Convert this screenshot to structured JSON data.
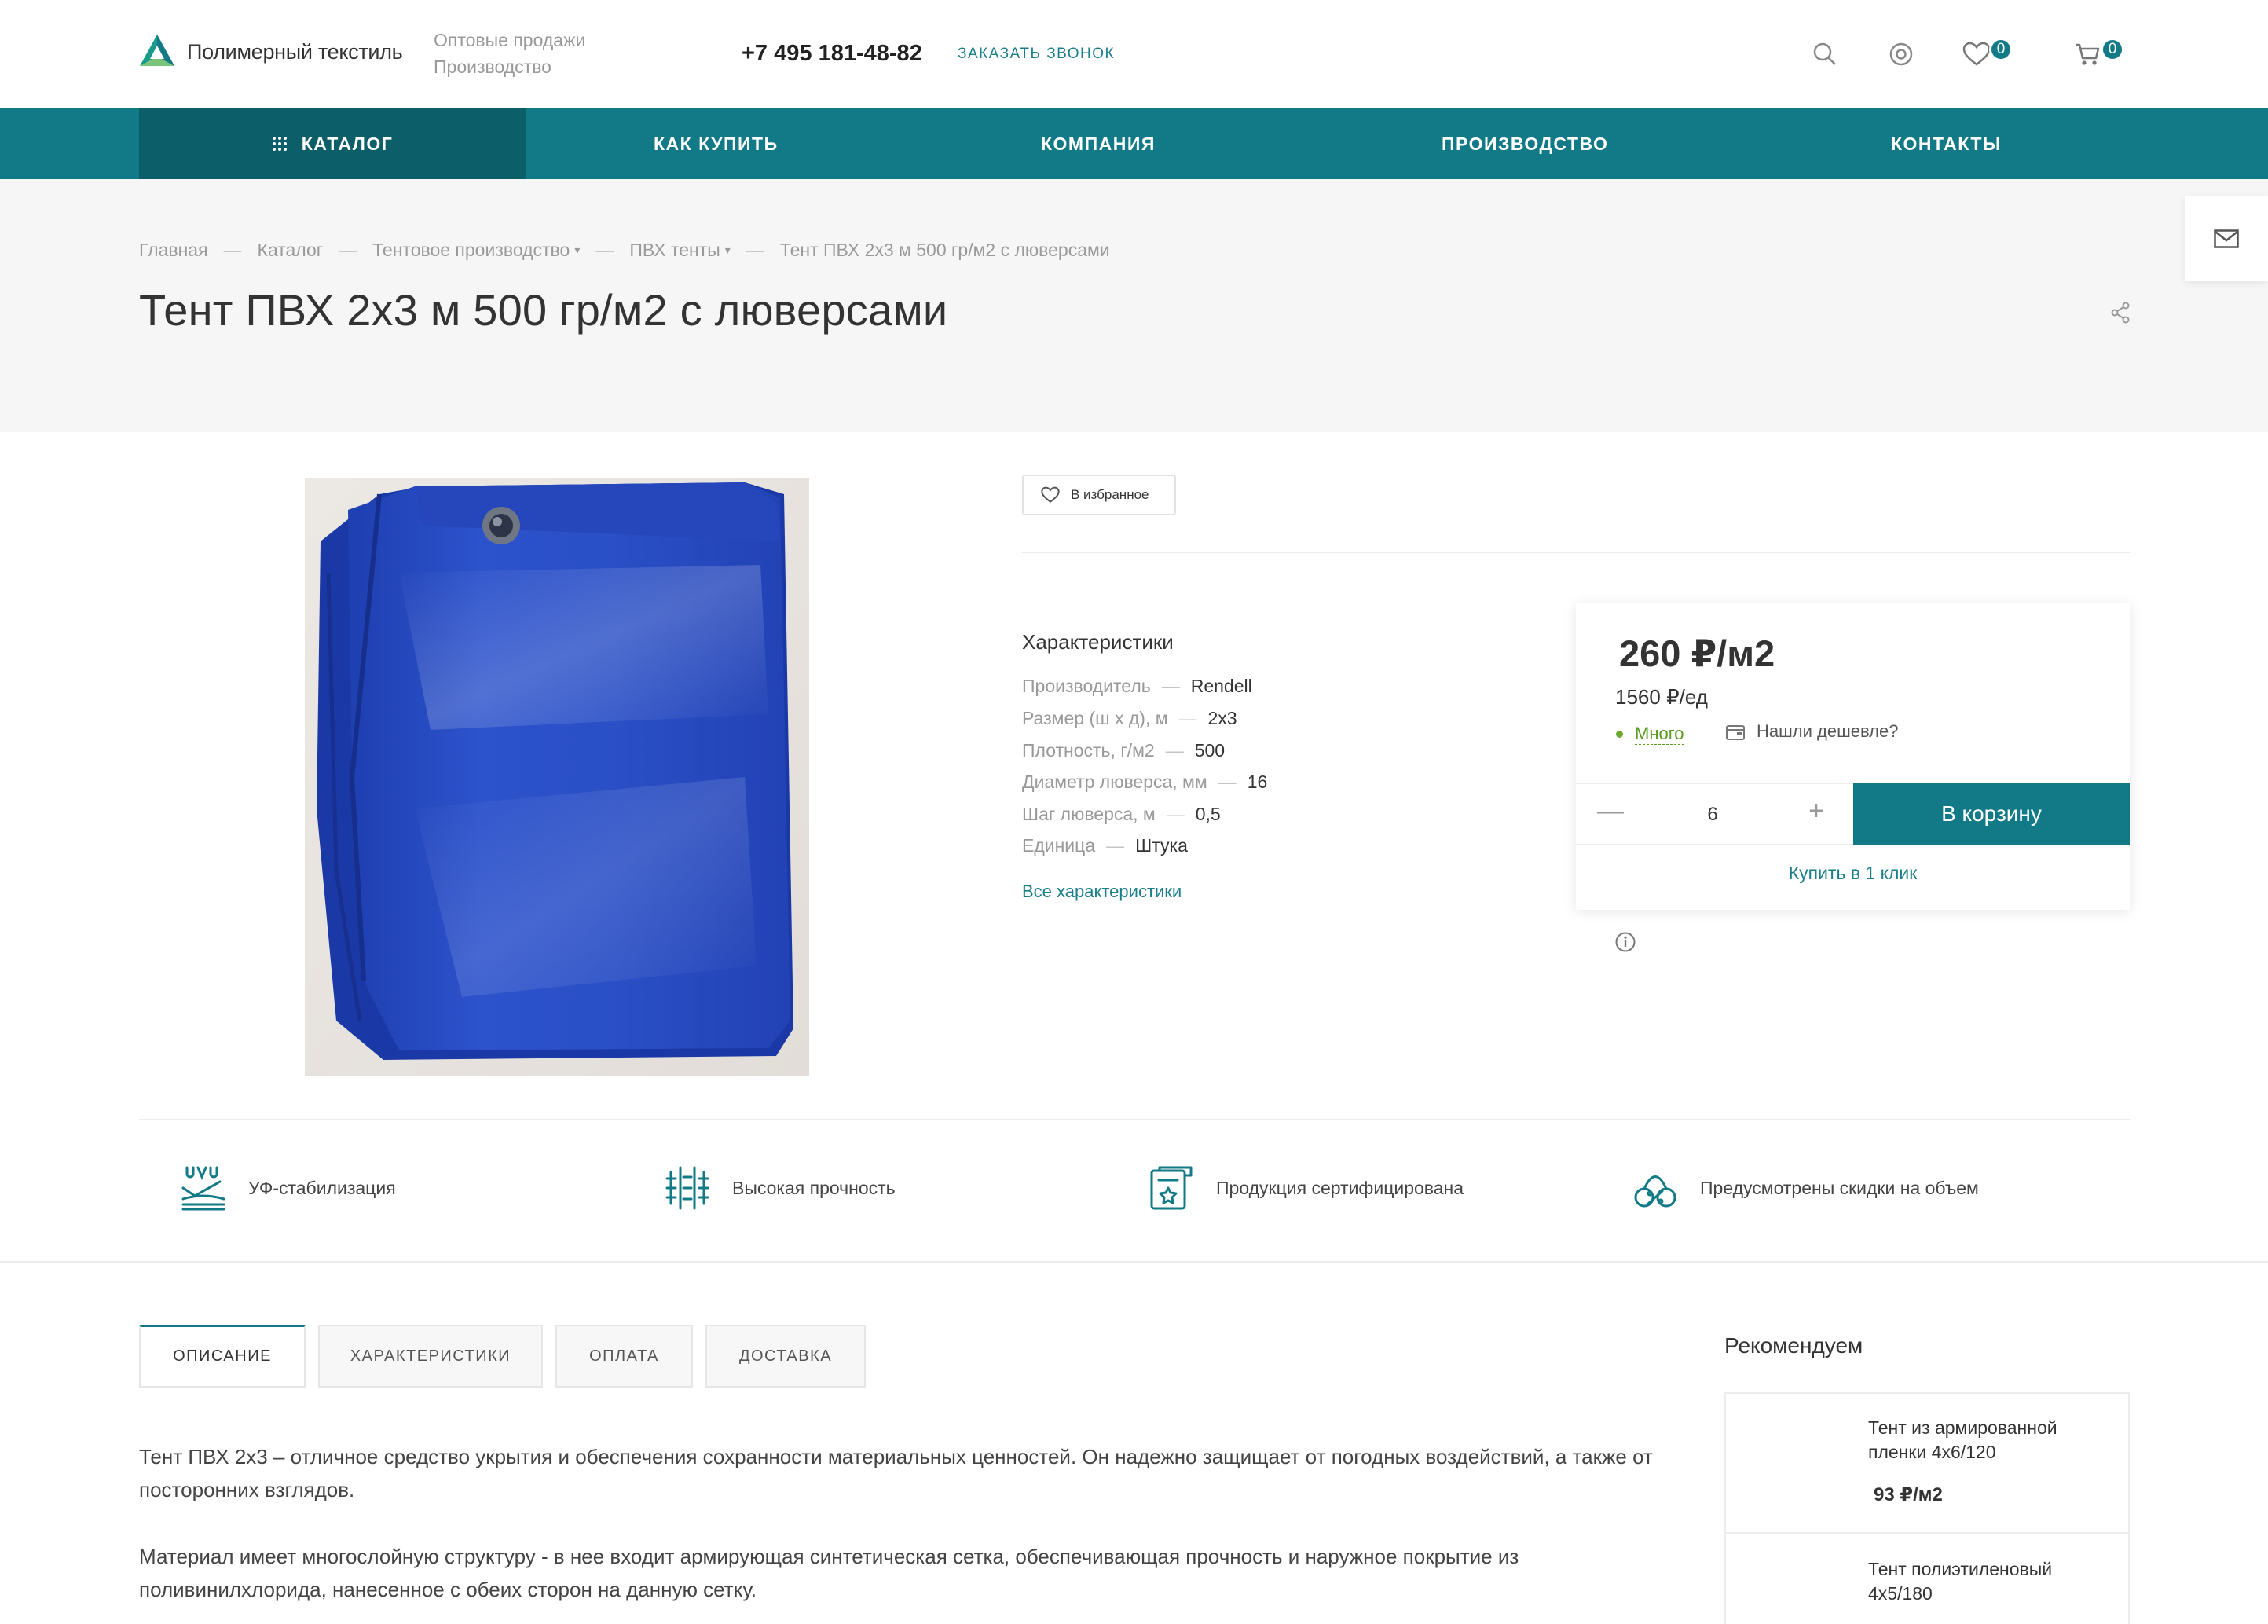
{
  "header": {
    "logo_text": "Полимерный текстиль",
    "sub_line1": "Оптовые продажи",
    "sub_line2": "Производство",
    "phone": "+7 495 181-48-82",
    "callback": "Заказать звонок",
    "favorites_count": "0",
    "cart_count": "0",
    "icons": [
      "search-icon",
      "user-icon",
      "heart-icon",
      "cart-icon"
    ]
  },
  "nav": {
    "catalog": "КАТАЛОГ",
    "items": [
      "КАК КУПИТЬ",
      "КОМПАНИЯ",
      "ПРОИЗВОДСТВО",
      "КОНТАКТЫ"
    ]
  },
  "breadcrumb": [
    "Главная",
    "Каталог",
    "Тентовое производство",
    "ПВХ тенты",
    "Тент ПВХ 2х3 м 500 гр/м2 с люверсами"
  ],
  "page_title": "Тент ПВХ 2х3 м 500 гр/м2 с люверсами",
  "product": {
    "favorite_label": "В избранное",
    "characteristics_title": "Характеристики",
    "characteristics": [
      {
        "key": "Производитель",
        "value": "Rendell"
      },
      {
        "key": "Размер (ш х д), м",
        "value": "2х3"
      },
      {
        "key": "Плотность, г/м2",
        "value": "500"
      },
      {
        "key": "Диаметр люверса, мм",
        "value": "16"
      },
      {
        "key": "Шаг люверса, м",
        "value": "0,5"
      },
      {
        "key": "Единица",
        "value": "Штука"
      }
    ],
    "all_characteristics": "Все характеристики",
    "price": "260 ₽/м2",
    "price_per_unit": "1560 ₽/ед",
    "stock": "Много",
    "cheaper": "Нашли дешевле?",
    "quantity": "6",
    "qty_minus": "—",
    "qty_plus": "+",
    "to_cart": "В корзину",
    "one_click": "Купить в 1 клик"
  },
  "features": [
    "УФ-стабилизация",
    "Высокая прочность",
    "Продукция сертифицирована",
    "Предусмотрены скидки на объем"
  ],
  "tabs": [
    "ОПИСАНИЕ",
    "ХАРАКТЕРИСТИКИ",
    "ОПЛАТА",
    "ДОСТАВКА"
  ],
  "description": [
    "Тент ПВХ 2х3 – отличное средство укрытия и обеспечения сохранности материальных ценностей. Он надежно защищает от погодных воздействий, а также от посторонних взглядов.",
    "Материал имеет многослойную структуру - в нее входит армирующая синтетическая сетка, обеспечивающая прочность и наружное покрытие из поливинилхлорида, нанесенное с обеих сторон на данную сетку."
  ],
  "recommend": {
    "title": "Рекомендуем",
    "items": [
      {
        "name": "Тент из армированной пленки 4х6/120",
        "price": "93 ₽/м2"
      },
      {
        "name": "Тент полиэтиленовый 4х5/180",
        "price": ""
      }
    ]
  },
  "colors": {
    "primary": "#127a86",
    "primary_dark": "#0c5e69",
    "accent_link": "#1a7f8a",
    "stock_green": "#5b9a22"
  }
}
